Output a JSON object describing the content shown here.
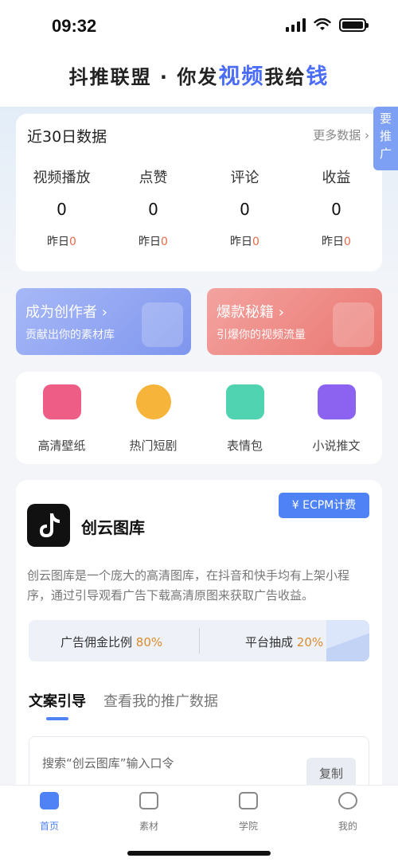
{
  "status_bar": {
    "time": "09:32"
  },
  "header": {
    "part1": "抖推联盟 · 你发",
    "highlight1": "视频",
    "part2": "我给",
    "highlight2": "钱"
  },
  "side_tab": {
    "line1": "要",
    "line2": "推",
    "line3": "广"
  },
  "stats": {
    "title": "近30日数据",
    "more_label": "更多数据",
    "yesterday_label": "昨日",
    "items": [
      {
        "label": "视频播放",
        "value": "0",
        "yesterday": "0"
      },
      {
        "label": "点赞",
        "value": "0",
        "yesterday": "0"
      },
      {
        "label": "评论",
        "value": "0",
        "yesterday": "0"
      },
      {
        "label": "收益",
        "value": "0",
        "yesterday": "0"
      }
    ]
  },
  "promos": [
    {
      "title": "成为创作者",
      "subtitle": "贡献出你的素材库"
    },
    {
      "title": "爆款秘籍",
      "subtitle": "引爆你的视频流量"
    }
  ],
  "categories": [
    {
      "label": "高清壁纸",
      "icon": "wallpaper-icon",
      "color": "#ee5d86"
    },
    {
      "label": "热门短剧",
      "icon": "smiley-icon",
      "color": "#f6b43a"
    },
    {
      "label": "表情包",
      "icon": "tv-icon",
      "color": "#4fd3b0"
    },
    {
      "label": "小说推文",
      "icon": "book-icon",
      "color": "#8b63f0"
    }
  ],
  "project": {
    "ecpm_label": "ECPM计费",
    "name": "创云图库",
    "description": "创云图库是一个庞大的高清图库，在抖音和快手均有上架小程序，通过引导观看广告下载高清原图来获取广告收益。",
    "commission_label": "广告佣金比例",
    "commission_value": "80%",
    "platform_label": "平台抽成",
    "platform_value": "20%"
  },
  "tabs": {
    "active": "文案引导",
    "inactive": "查看我的推广数据"
  },
  "copy_panel": {
    "text": "搜索“创云图库”输入口令",
    "button": "复制"
  },
  "nav": [
    {
      "label": "首页",
      "icon": "home-icon",
      "active": true
    },
    {
      "label": "素材",
      "icon": "video-camera-icon"
    },
    {
      "label": "学院",
      "icon": "graduation-cap-icon"
    },
    {
      "label": "我的",
      "icon": "profile-icon"
    }
  ],
  "colors": {
    "accent": "#4f83f5",
    "highlight_number": "#e86a4a",
    "percent": "#d98b2b"
  }
}
